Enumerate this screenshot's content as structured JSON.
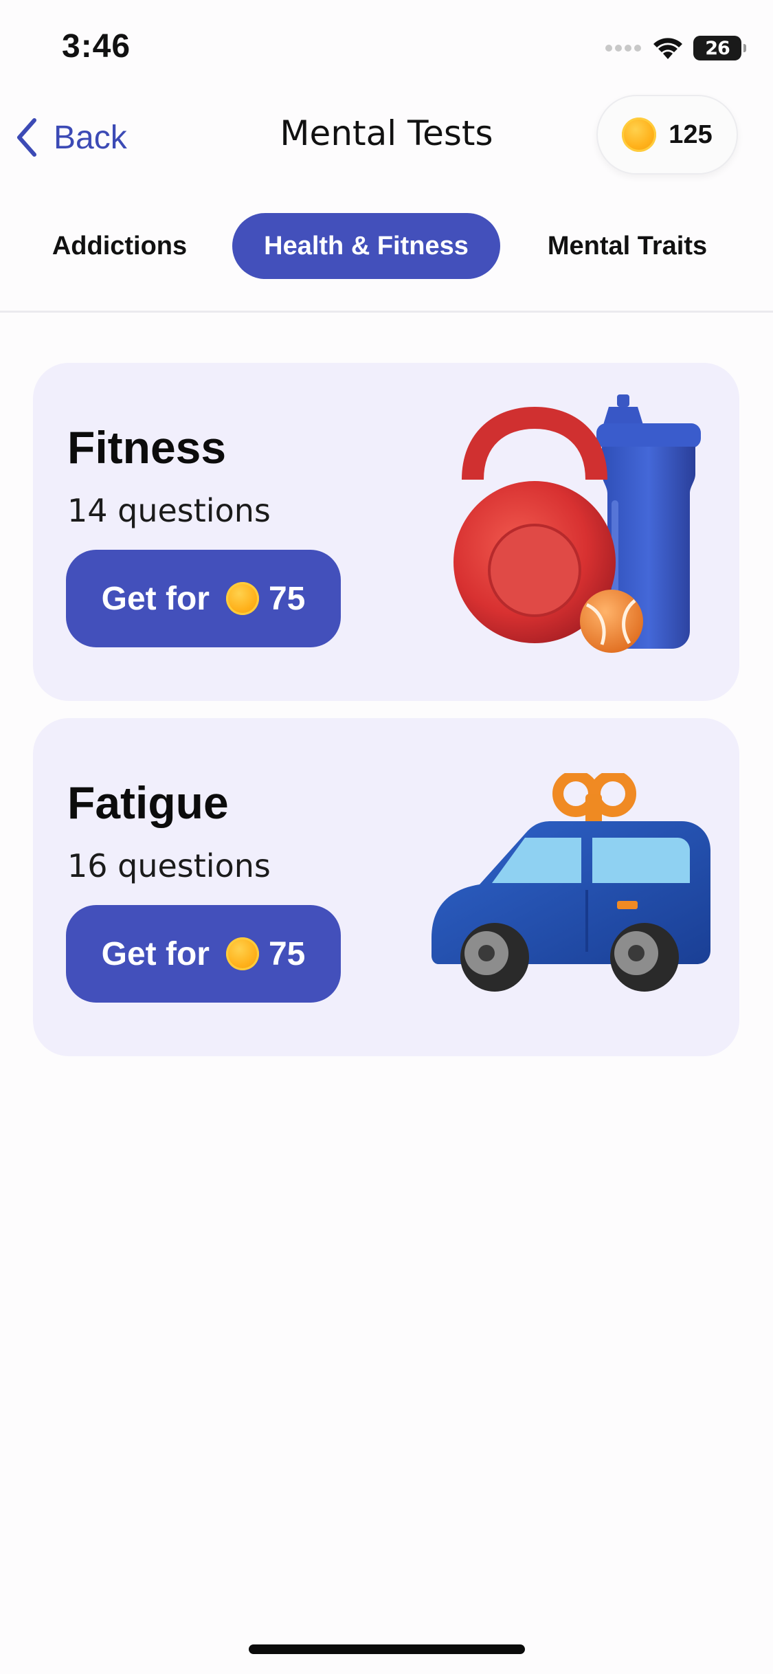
{
  "status_bar": {
    "time": "3:46",
    "battery": "26"
  },
  "nav": {
    "back_label": "Back",
    "title": "Mental Tests",
    "coins": "125"
  },
  "tabs": [
    {
      "label": "Addictions",
      "active": false
    },
    {
      "label": "Health & Fitness",
      "active": true
    },
    {
      "label": "Mental Traits",
      "active": false
    }
  ],
  "cards": [
    {
      "title": "Fitness",
      "subtitle": "14 questions",
      "button_label": "Get for",
      "price": "75",
      "icon": "kettlebell-bottle-ball-icon"
    },
    {
      "title": "Fatigue",
      "subtitle": "16 questions",
      "button_label": "Get for",
      "price": "75",
      "icon": "windup-toy-car-icon"
    }
  ],
  "colors": {
    "accent": "#4350bb",
    "card_bg": "#f1effc",
    "coin": "#ffb21c"
  }
}
